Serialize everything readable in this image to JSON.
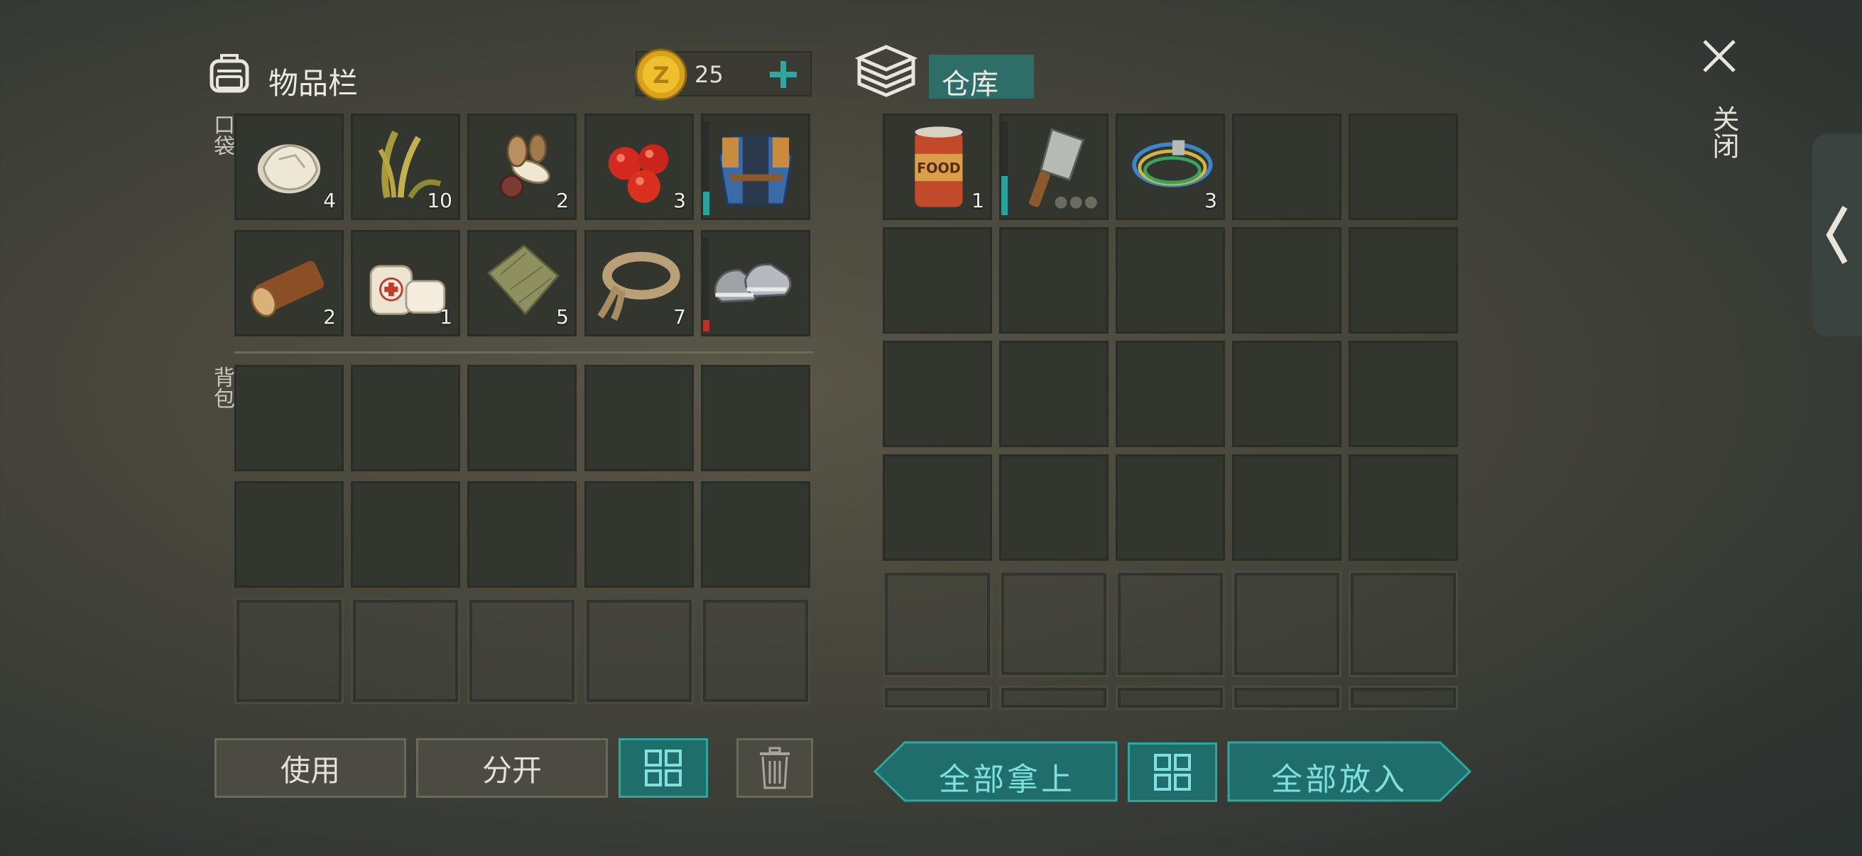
{
  "inventory": {
    "title": "物品栏",
    "coins": "25",
    "pockets_label": "口袋",
    "backpack_label": "背包",
    "pockets": [
      {
        "icon": "stone-icon",
        "qty": "4"
      },
      {
        "icon": "plant-fiber-icon",
        "qty": "10"
      },
      {
        "icon": "seeds-icon",
        "qty": "2"
      },
      {
        "icon": "berries-icon",
        "qty": "3"
      },
      {
        "icon": "vest-icon",
        "qty": "",
        "durability_color": "#2aa39d",
        "durability": 0.25
      },
      {
        "icon": "log-icon",
        "qty": "2"
      },
      {
        "icon": "bandage-icon",
        "qty": "1"
      },
      {
        "icon": "cloth-icon",
        "qty": "5"
      },
      {
        "icon": "rope-icon",
        "qty": "7"
      },
      {
        "icon": "sneakers-icon",
        "qty": "",
        "durability_color": "#c0302b",
        "durability": 0.12
      }
    ]
  },
  "storage": {
    "title": "仓库",
    "items": [
      {
        "icon": "canned-food-icon",
        "qty": "1"
      },
      {
        "icon": "cleaver-icon",
        "qty": "",
        "durability_color": "#2aa39d",
        "durability": 0.42
      },
      {
        "icon": "wire-icon",
        "qty": "3"
      }
    ]
  },
  "buttons": {
    "use": "使用",
    "split": "分开",
    "take_all": "全部拿上",
    "put_all": "全部放入"
  },
  "close_label": "关闭",
  "colors": {
    "accent": "#2fa7a1",
    "button_teal": "#1f6e6b"
  }
}
